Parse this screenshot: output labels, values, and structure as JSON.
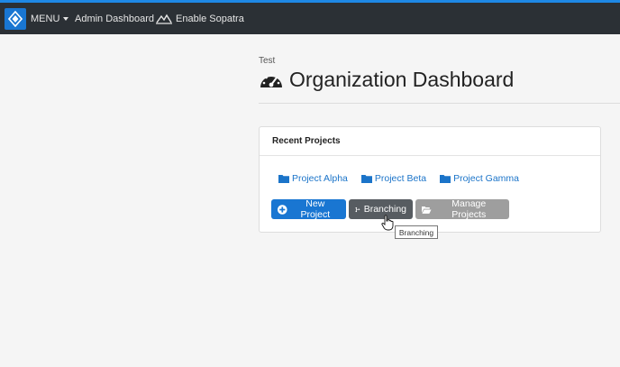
{
  "topbar": {
    "menu_label": "MENU",
    "admin_label": "Admin Dashboard",
    "sopatra_label": "Enable Sopatra",
    "logo_icon": "diamond-logo-icon",
    "accent": "#1e88e5"
  },
  "header": {
    "org_label": "Test",
    "title": "Organization Dashboard",
    "icon": "gauge-icon"
  },
  "panel": {
    "heading": "Recent Projects",
    "projects": [
      {
        "label": "Project Alpha",
        "icon": "folder-icon"
      },
      {
        "label": "Project Beta",
        "icon": "folder-icon"
      },
      {
        "label": "Project Gamma",
        "icon": "folder-icon"
      }
    ],
    "buttons": {
      "new_project": "New Project",
      "branching": "Branching",
      "manage_projects": "Manage Projects"
    }
  },
  "tooltip": {
    "text": "Branching"
  },
  "colors": {
    "primary": "#1976d2",
    "dark_button": "#575c61",
    "disabled_button": "#9e9e9e",
    "link": "#1b74c9"
  }
}
